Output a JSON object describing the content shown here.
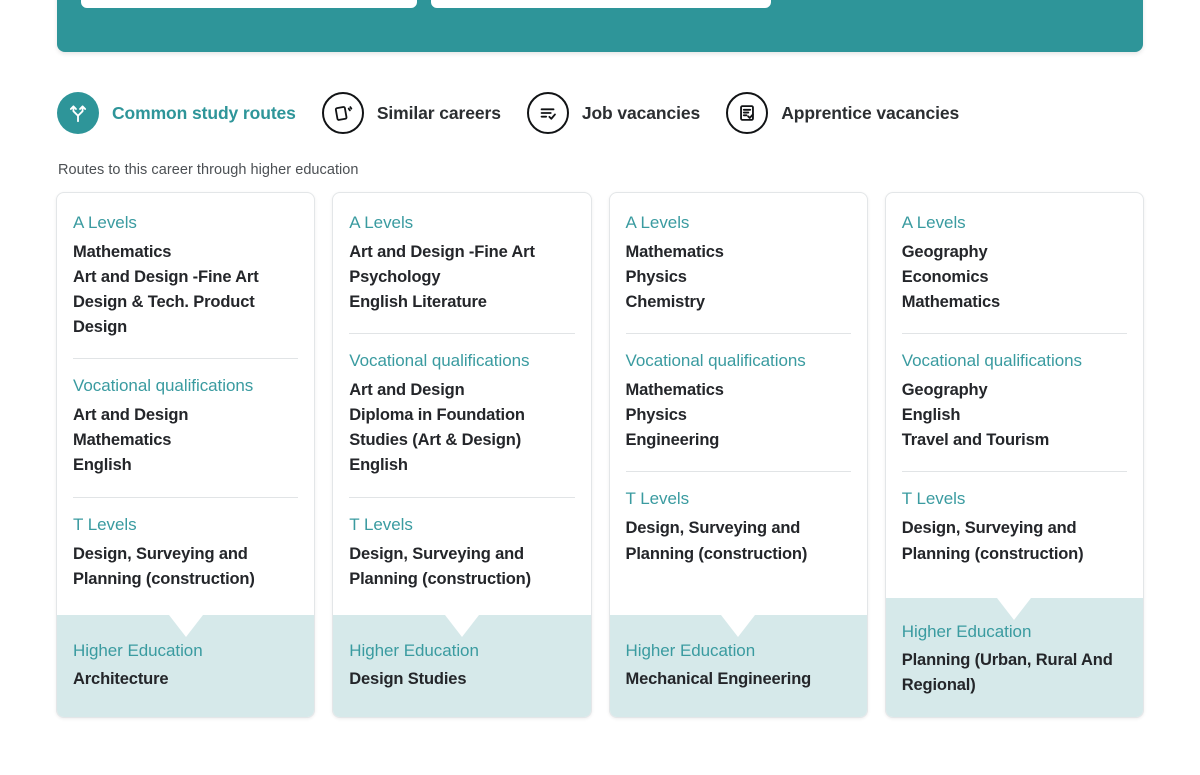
{
  "banner": {
    "fields": [
      {
        "name": "banner-input-1",
        "value": ""
      },
      {
        "name": "banner-input-2",
        "value": ""
      }
    ],
    "color": "#2E9599"
  },
  "tabs": [
    {
      "label": "Common study routes",
      "icon": "study-routes-fork-icon",
      "active": true
    },
    {
      "label": "Similar careers",
      "icon": "cards-swipe-icon",
      "active": false
    },
    {
      "label": "Job vacancies",
      "icon": "list-check-icon",
      "active": false
    },
    {
      "label": "Apprentice vacancies",
      "icon": "document-check-icon",
      "active": false
    }
  ],
  "section": {
    "subtitle": "Routes to this career through higher education"
  },
  "colors": {
    "teal": "#2E9599",
    "teal_heading": "#3A9BA0",
    "light_teal": "#D6E9EA",
    "text_dark": "#24262A"
  },
  "cards": [
    {
      "blocks": [
        {
          "title": "A Levels",
          "items": [
            "Mathematics",
            "Art and Design -Fine Art",
            "Design & Tech. Product Design"
          ]
        },
        {
          "title": "Vocational qualifications",
          "items": [
            "Art and Design",
            "Mathematics",
            "English"
          ]
        },
        {
          "title": "T Levels",
          "items": [
            "Design, Surveying and Planning (construction)"
          ]
        }
      ],
      "higher_education": {
        "title": "Higher Education",
        "value": "Architecture"
      }
    },
    {
      "blocks": [
        {
          "title": "A Levels",
          "items": [
            "Art and Design -Fine Art",
            "Psychology",
            "English Literature"
          ]
        },
        {
          "title": "Vocational qualifications",
          "items": [
            "Art and Design",
            "Diploma in Foundation Studies (Art & Design)",
            "English"
          ]
        },
        {
          "title": "T Levels",
          "items": [
            "Design, Surveying and Planning (construction)"
          ]
        }
      ],
      "higher_education": {
        "title": "Higher Education",
        "value": "Design Studies"
      }
    },
    {
      "blocks": [
        {
          "title": "A Levels",
          "items": [
            "Mathematics",
            "Physics",
            "Chemistry"
          ]
        },
        {
          "title": "Vocational qualifications",
          "items": [
            "Mathematics",
            "Physics",
            "Engineering"
          ]
        },
        {
          "title": "T Levels",
          "items": [
            "Design, Surveying and Planning (construction)"
          ]
        }
      ],
      "higher_education": {
        "title": "Higher Education",
        "value": "Mechanical Engineering"
      }
    },
    {
      "blocks": [
        {
          "title": "A Levels",
          "items": [
            "Geography",
            "Economics",
            "Mathematics"
          ]
        },
        {
          "title": "Vocational qualifications",
          "items": [
            "Geography",
            "English",
            "Travel and Tourism"
          ]
        },
        {
          "title": "T Levels",
          "items": [
            "Design, Surveying and Planning (construction)"
          ]
        }
      ],
      "higher_education": {
        "title": "Higher Education",
        "value": "Planning (Urban, Rural And Regional)"
      }
    }
  ]
}
